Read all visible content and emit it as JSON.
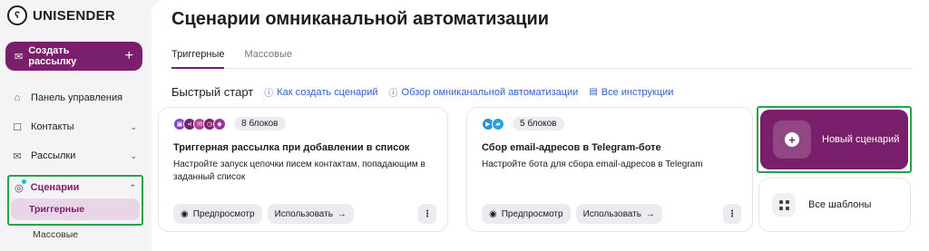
{
  "app": {
    "logo_text": "UNISENDER"
  },
  "sidebar": {
    "create_label": "Создать рассылку",
    "items": [
      {
        "label": "Панель управления"
      },
      {
        "label": "Контакты"
      },
      {
        "label": "Рассылки"
      }
    ],
    "scenarios": {
      "label": "Сценарии",
      "sub_active": "Триггерные",
      "sub_other": "Массовые"
    }
  },
  "main": {
    "title": "Сценарии омниканальной автоматизации",
    "tabs": [
      {
        "label": "Триггерные",
        "active": true
      },
      {
        "label": "Массовые",
        "active": false
      }
    ],
    "quick_start": {
      "title": "Быстрый старт",
      "links": [
        {
          "label": "Как создать сценарий"
        },
        {
          "label": "Обзор омниканальной автоматизации"
        },
        {
          "label": "Все инструкции"
        }
      ]
    },
    "cards": [
      {
        "blocks": "8 блоков",
        "title": "Триггерная рассылка при добавлении в список",
        "desc": "Настройте запуск цепочки писем контактам, попадающим в заданный список",
        "preview": "Предпросмотр",
        "use": "Использовать"
      },
      {
        "blocks": "5 блоков",
        "title": "Сбор email-адресов в Telegram-боте",
        "desc": "Настройте бота для сбора email-адресов в Telegram",
        "preview": "Предпросмотр",
        "use": "Использовать"
      }
    ],
    "new_scenario": "Новый сценарий",
    "all_templates": "Все шаблоны"
  },
  "colors": {
    "brand": "#7a1f6b",
    "link": "#2f5fd0",
    "highlight": "#2aa24a"
  }
}
